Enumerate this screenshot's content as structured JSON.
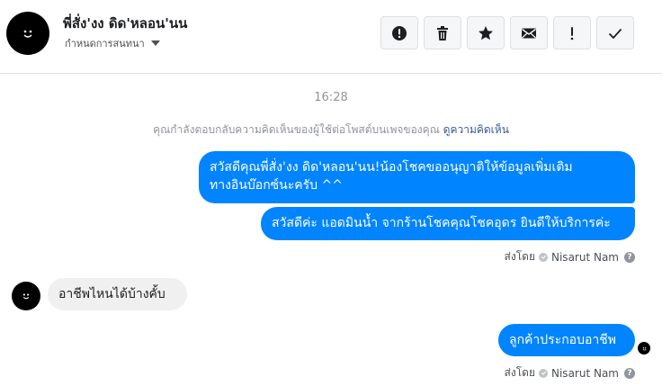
{
  "header": {
    "contact_name": "พี่สั่ง'งง ดิด'หลอน'นน",
    "assign_label": "กำหนดการสนทนา",
    "toolbar": [
      {
        "icon": "alert-circle-icon",
        "glyph": "!"
      },
      {
        "icon": "trash-icon"
      },
      {
        "icon": "star-icon"
      },
      {
        "icon": "envelope-icon"
      },
      {
        "icon": "exclamation-icon",
        "glyph": "!"
      },
      {
        "icon": "checkmark-icon"
      }
    ]
  },
  "conversation": {
    "timestamp": "16:28",
    "notice_text": "คุณกำลังตอบกลับความคิดเห็นของผู้ใช้ต่อโพสต์บนเพจของคุณ",
    "notice_link": "ดูความคิดเห็น",
    "messages": [
      {
        "from": "page",
        "line1": "สวัสดีคุณพี่สั่ง'งง ดิด'หลอน'นน!น้องโชคขออนุญาติให้ข้อมูลเพิ่มเติม",
        "line2": "ทางอินบ๊อกซ์นะครับ ^^"
      },
      {
        "from": "page",
        "text": "สวัสดีค่ะ แอดมินน้ำ จากร้านโชคคุณโชคอุดร ยินดีให้บริการค่ะ"
      },
      {
        "from": "user",
        "text": "อาชีพไหนได้บ้างคั้บ"
      },
      {
        "from": "page",
        "text": "ลูกค้าประกอบอาชีพ"
      }
    ],
    "sent_by_label": "ส่งโดย",
    "sender_name": "Nisarut Nam",
    "help_glyph": "?"
  },
  "colors": {
    "outgoing_bubble": "#0084ff",
    "incoming_bubble": "#f1f0f0",
    "link": "#385898",
    "muted_text": "#90949c"
  }
}
